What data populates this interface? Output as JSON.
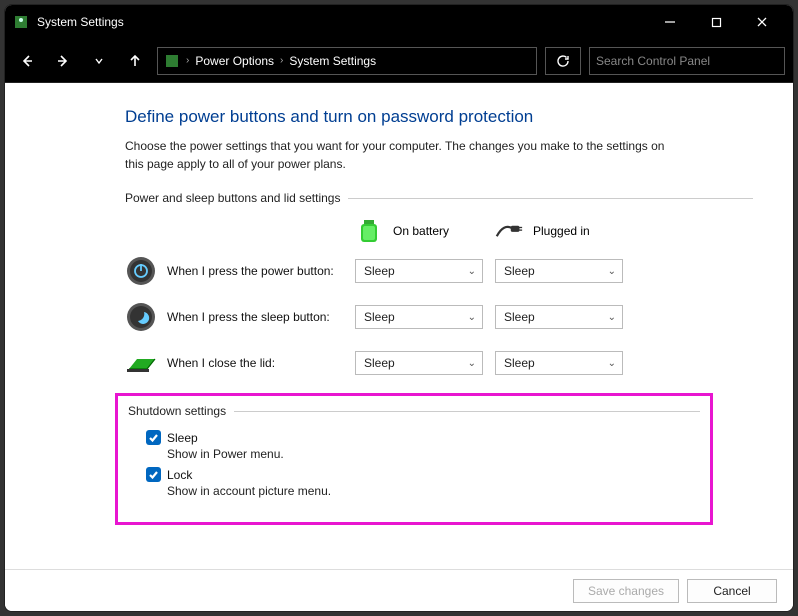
{
  "window": {
    "title": "System Settings"
  },
  "breadcrumb": {
    "items": [
      "Power Options",
      "System Settings"
    ]
  },
  "search": {
    "placeholder": "Search Control Panel"
  },
  "page": {
    "title": "Define power buttons and turn on password protection",
    "description": "Choose the power settings that you want for your computer. The changes you make to the settings on this page apply to all of your power plans."
  },
  "buttons_section": {
    "heading": "Power and sleep buttons and lid settings",
    "columns": {
      "battery": "On battery",
      "plugged": "Plugged in"
    },
    "rows": [
      {
        "icon": "power",
        "label": "When I press the power button:",
        "battery": "Sleep",
        "plugged": "Sleep"
      },
      {
        "icon": "sleep",
        "label": "When I press the sleep button:",
        "battery": "Sleep",
        "plugged": "Sleep"
      },
      {
        "icon": "lid",
        "label": "When I close the lid:",
        "battery": "Sleep",
        "plugged": "Sleep"
      }
    ]
  },
  "shutdown_section": {
    "heading": "Shutdown settings",
    "items": [
      {
        "label": "Sleep",
        "description": "Show in Power menu.",
        "checked": true
      },
      {
        "label": "Lock",
        "description": "Show in account picture menu.",
        "checked": true
      }
    ]
  },
  "footer": {
    "save": "Save changes",
    "cancel": "Cancel"
  }
}
